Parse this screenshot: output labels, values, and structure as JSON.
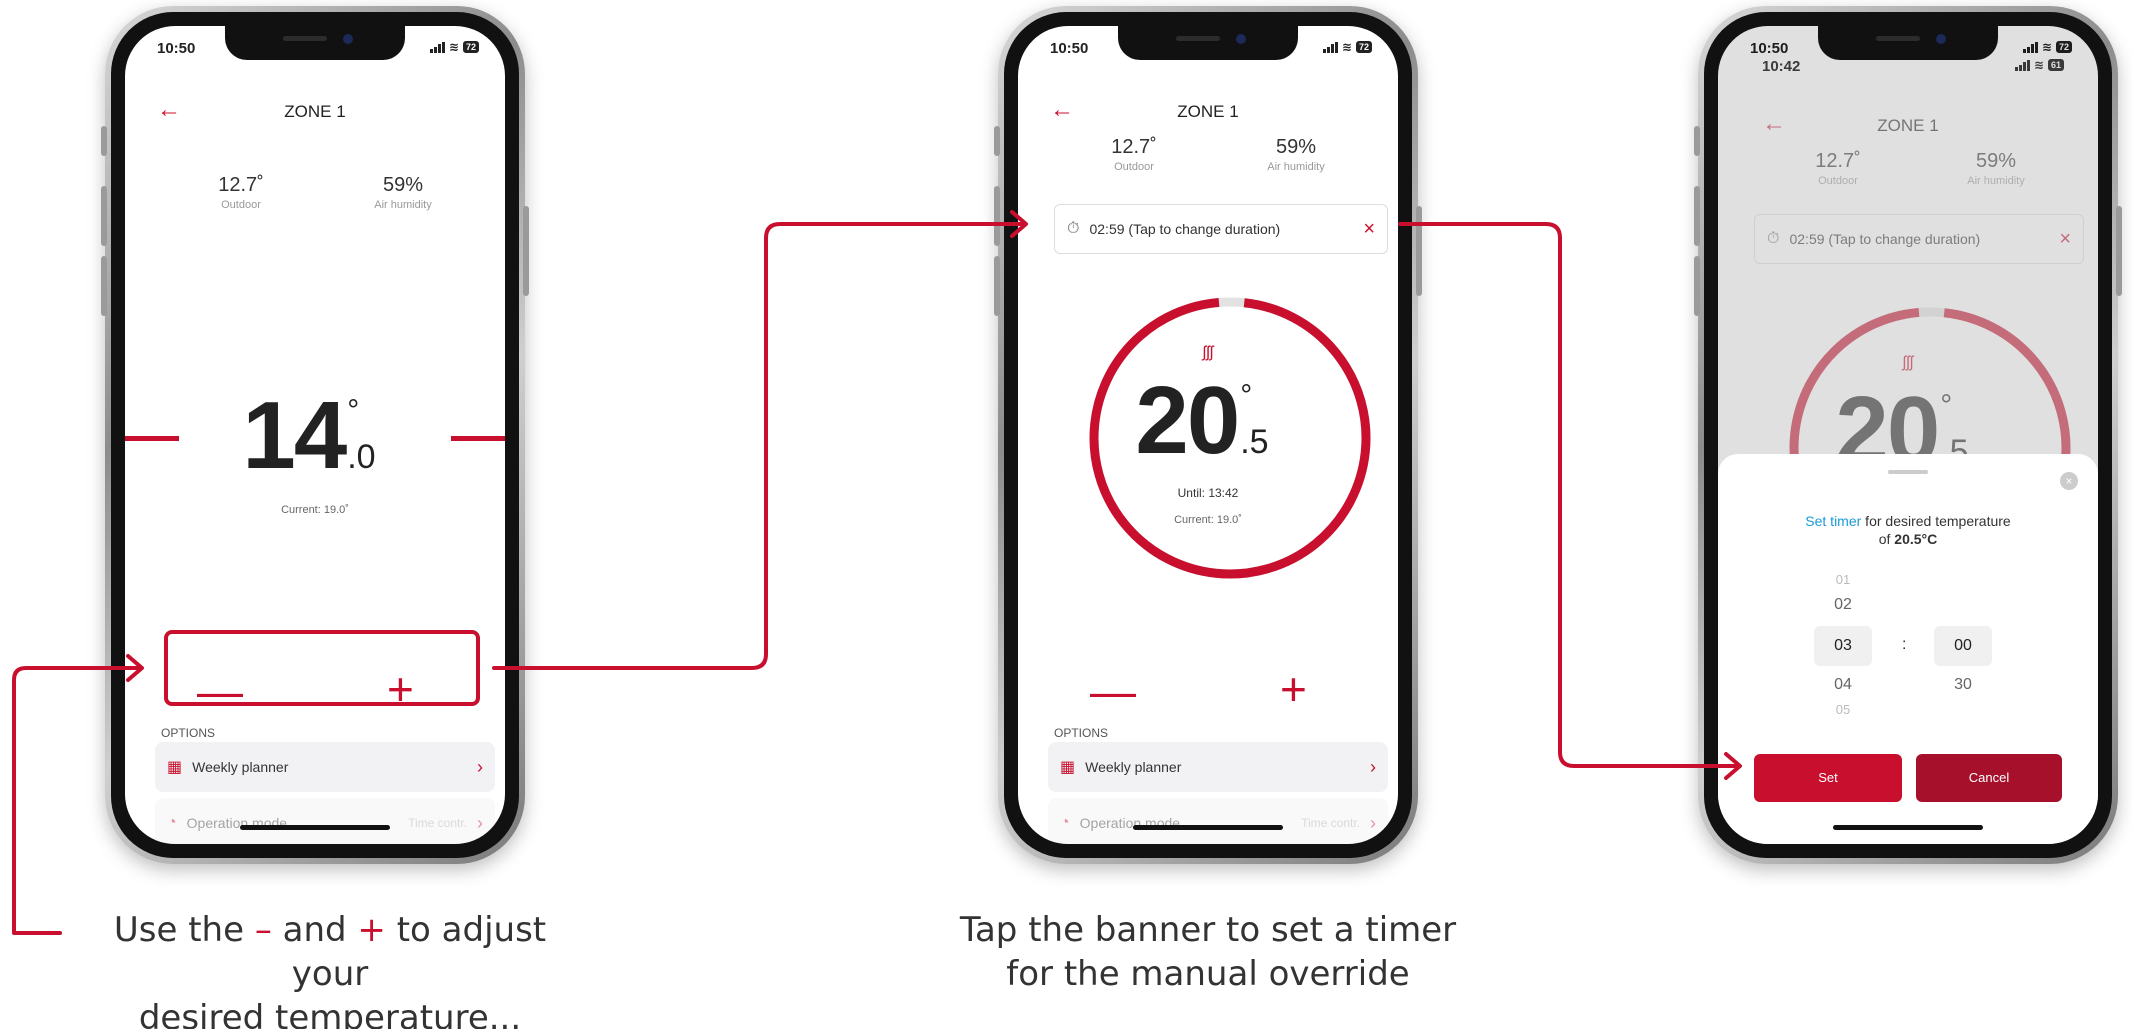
{
  "status_time": "10:50",
  "status_time_under": "10:42",
  "battery": "72",
  "battery_under": "61",
  "zone_title": "ZONE 1",
  "outdoor": {
    "value": "12.7˚",
    "label": "Outdoor"
  },
  "humidity": {
    "value": "59%",
    "label": "Air humidity"
  },
  "screen1": {
    "temp_int": "14",
    "temp_dec": ".0",
    "deg": "°",
    "current": "Current: 19.0˚",
    "minus": "—",
    "plus": "+"
  },
  "screen2": {
    "banner": "02:59 (Tap to change duration)",
    "heat_icon": "ʃʃʃ",
    "temp_int": "20",
    "temp_dec": ".5",
    "deg": "°",
    "until": "Until: 13:42",
    "current": "Current: 19.0˚",
    "minus": "—",
    "plus": "+",
    "progress": 0.97
  },
  "options": {
    "label": "OPTIONS",
    "weekly": "Weekly planner",
    "operation": "Operation mode",
    "operation_value": "Time contr."
  },
  "sheet": {
    "title_link": "Set timer",
    "title_rest": " for desired temperature",
    "title_line2_pre": "of ",
    "title_temp": "20.5°C",
    "hours": [
      "01",
      "02",
      "03",
      "04",
      "05"
    ],
    "minutes": [
      "00",
      "30"
    ],
    "colon": ":",
    "set": "Set",
    "cancel": "Cancel"
  },
  "captions": {
    "c1_a": "Use the ",
    "c1_minus": "–",
    "c1_b": " and ",
    "c1_plus": "+",
    "c1_c": " to adjust your",
    "c1_line2": "desired temperature...",
    "c2_line1": "Tap the banner to set a timer",
    "c2_line2": "for the manual override"
  },
  "colors": {
    "accent": "#c8102e",
    "link": "#1a9bd7",
    "cancel": "#a6102a"
  }
}
